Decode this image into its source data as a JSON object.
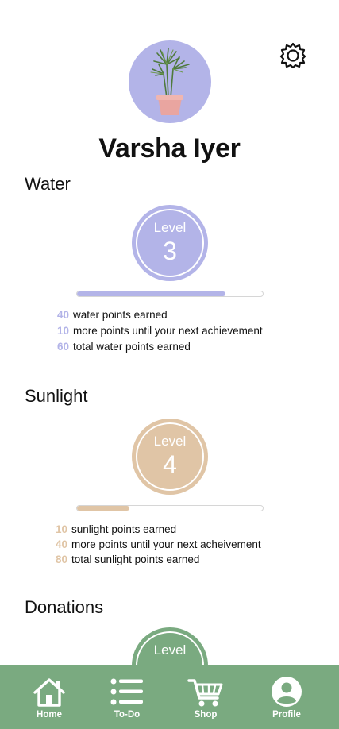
{
  "profile": {
    "name": "Varsha Iyer",
    "avatar_icon": "potted-plant-icon",
    "settings_icon": "gear-icon"
  },
  "sections": {
    "water": {
      "title": "Water",
      "level_word": "Level",
      "level": "3",
      "progress": 0.8,
      "color": "#b3b4e8",
      "stats": [
        {
          "n": "40",
          "text": "water points earned"
        },
        {
          "n": "10",
          "text": "more points until your next achievement"
        },
        {
          "n": "60",
          "text": "total water points earned"
        }
      ]
    },
    "sunlight": {
      "title": "Sunlight",
      "level_word": "Level",
      "level": "4",
      "progress": 0.28,
      "color": "#e0c5a6",
      "stats": [
        {
          "n": "10",
          "text": "sunlight points earned"
        },
        {
          "n": "40",
          "text": "more points until your next acheivement"
        },
        {
          "n": "80",
          "text": "total sunlight points earned"
        }
      ]
    },
    "donations": {
      "title": "Donations",
      "level_word": "Level",
      "color": "#7aaa80"
    }
  },
  "nav": {
    "background": "#7aaa80",
    "items": [
      {
        "label": "Home",
        "icon": "home-icon"
      },
      {
        "label": "To-Do",
        "icon": "list-icon"
      },
      {
        "label": "Shop",
        "icon": "cart-icon"
      },
      {
        "label": "Profile",
        "icon": "user-circle-icon"
      }
    ]
  }
}
